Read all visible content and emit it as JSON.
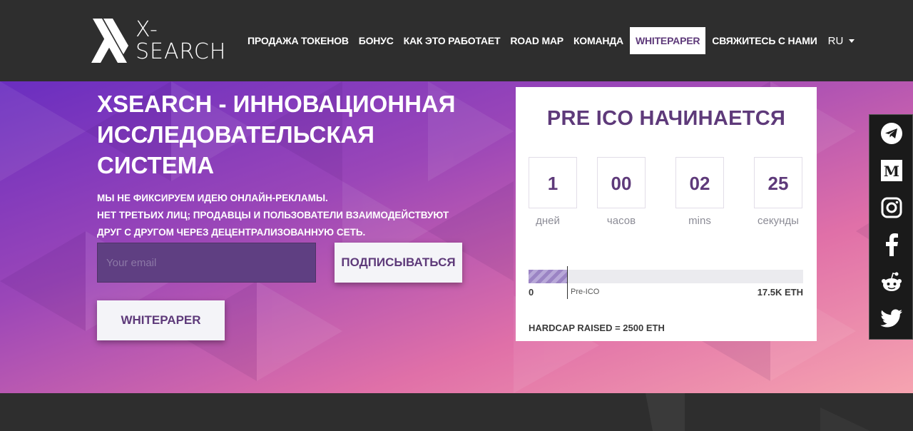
{
  "brand": {
    "logo_line1": "X-",
    "logo_line2": "SEARCH"
  },
  "nav": {
    "items": [
      {
        "label": "ПРОДАЖА ТОКЕНОВ",
        "active": false
      },
      {
        "label": "БОНУС",
        "active": false
      },
      {
        "label": "КАК ЭТО РАБОТАЕТ",
        "active": false
      },
      {
        "label": "ROAD MAP",
        "active": false
      },
      {
        "label": "КОМАНДА",
        "active": false
      },
      {
        "label": "WHITEPAPER",
        "active": true
      },
      {
        "label": "СВЯЖИТЕСЬ С НАМИ",
        "active": false
      }
    ],
    "lang": "RU"
  },
  "hero": {
    "title": "XSEARCH - ИННОВАЦИОННАЯ ИССЛЕДОВАТЕЛЬСКАЯ СИСТЕМА",
    "desc_line1": "МЫ НЕ ФИКСИРУЕМ ИДЕЮ ОНЛАЙН-РЕКЛАМЫ.",
    "desc_line2": "НЕТ ТРЕТЬИХ ЛИЦ; ПРОДАВЦЫ И ПОЛЬЗОВАТЕЛИ ВЗАИМОДЕЙСТВУЮТ",
    "desc_line3": "ДРУГ С ДРУГОМ ЧЕРЕЗ ДЕЦЕНТРАЛИЗОВАННУЮ СЕТЬ.",
    "email_placeholder": "Your email",
    "email_value": "",
    "subscribe_label": "ПОДПИСЫВАТЬСЯ",
    "whitepaper_label": "WHITEPAPER"
  },
  "countdown": {
    "title": "PRE ICO НАЧИНАЕТСЯ",
    "units": [
      {
        "value": "1",
        "label": "дней"
      },
      {
        "value": "00",
        "label": "часов"
      },
      {
        "value": "02",
        "label": "mins"
      },
      {
        "value": "25",
        "label": "секунды"
      }
    ]
  },
  "progress": {
    "min_label": "0",
    "stage_label": "Pre-ICO",
    "max_label": "17.5K ETH",
    "fill_fraction": 0.14,
    "hardcap_text": "HARDCAP RAISED = 2500 ETH"
  },
  "social": {
    "icons": [
      "telegram-icon",
      "medium-icon",
      "instagram-icon",
      "facebook-icon",
      "reddit-icon",
      "twitter-icon"
    ]
  },
  "colors": {
    "header_bg": "#2e2e2e",
    "accent_purple": "#5e3a7a",
    "input_bg": "#5f3f82"
  }
}
